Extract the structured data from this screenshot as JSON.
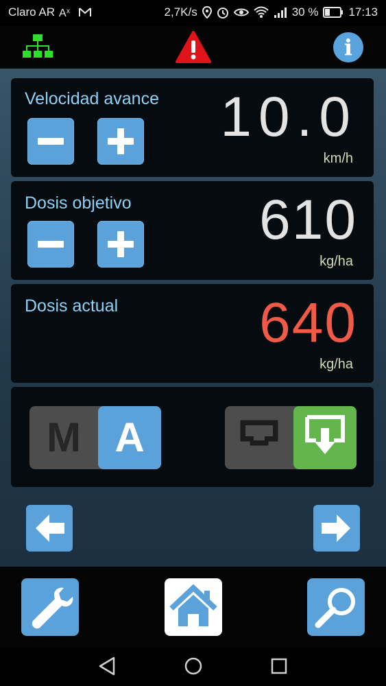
{
  "status_bar": {
    "carrier": "Claro AR",
    "speed": "2,7K/s",
    "battery": "30 %",
    "time": "17:13",
    "icons": [
      "translate-icon",
      "gmail-icon",
      "location-icon",
      "alarm-icon",
      "eye-icon",
      "wifi-icon",
      "signal-icon",
      "battery-icon"
    ]
  },
  "app_bar": {
    "icons": [
      "network-icon",
      "warning-icon",
      "info-icon"
    ],
    "warning_symbol": "!",
    "info_symbol": "i",
    "colors": {
      "network": "#2ee02e",
      "warning": "#e0131b",
      "info": "#5aa4dd"
    }
  },
  "velocidad": {
    "label": "Velocidad avance",
    "value": "10.0",
    "unit": "km/h"
  },
  "dosis_objetivo": {
    "label": "Dosis objetivo",
    "value": "610",
    "unit": "kg/ha"
  },
  "dosis_actual": {
    "label": "Dosis actual",
    "value": "640",
    "unit": "kg/ha",
    "value_color": "#f05a47"
  },
  "mode": {
    "manual_label": "M",
    "auto_label": "A",
    "selected": "A",
    "output_selected": "download"
  },
  "nav": {
    "prev_icon": "arrow-left-icon",
    "next_icon": "arrow-right-icon"
  },
  "bottom_nav": {
    "items": [
      "wrench-icon",
      "home-icon",
      "search-icon"
    ],
    "active": "home-icon"
  },
  "colors": {
    "accent_blue": "#5aa2d9",
    "green": "#62b64b",
    "label_blue": "#8fd0f5"
  }
}
